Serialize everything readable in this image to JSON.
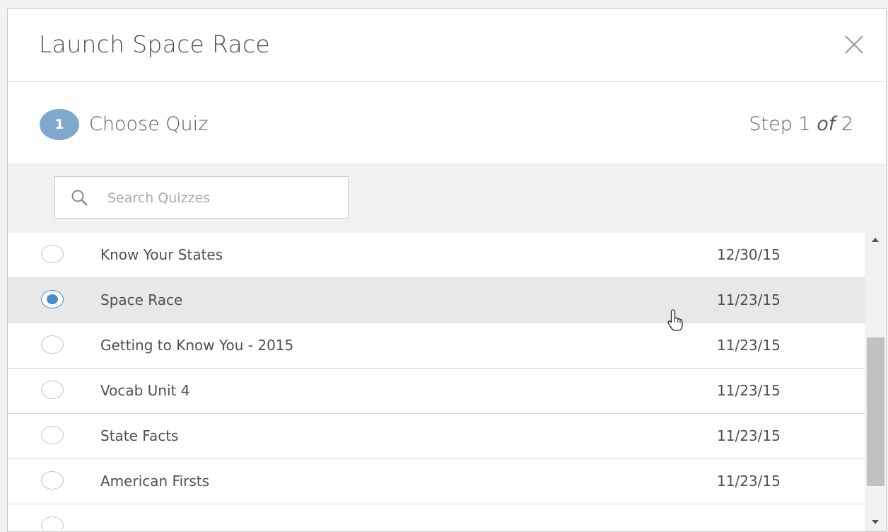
{
  "modal": {
    "title": "Launch Space Race",
    "close_icon": "close-icon"
  },
  "step": {
    "number": "1",
    "label": "Choose Quiz",
    "prefix": "Step 1 ",
    "of": "of",
    "total": " 2"
  },
  "search": {
    "placeholder": "Search Quizzes",
    "icon": "search-icon"
  },
  "quizzes": [
    {
      "name": "Know Your States",
      "date": "12/30/15",
      "selected": false
    },
    {
      "name": "Space Race",
      "date": "11/23/15",
      "selected": true
    },
    {
      "name": "Getting to Know You - 2015",
      "date": "11/23/15",
      "selected": false
    },
    {
      "name": "Vocab Unit 4",
      "date": "11/23/15",
      "selected": false
    },
    {
      "name": "State Facts",
      "date": "11/23/15",
      "selected": false
    },
    {
      "name": "American Firsts",
      "date": "11/23/15",
      "selected": false
    }
  ],
  "colors": {
    "accent": "#4a8bd0",
    "step_badge": "#7fa9cc",
    "selected_row": "#e8e8e8"
  }
}
